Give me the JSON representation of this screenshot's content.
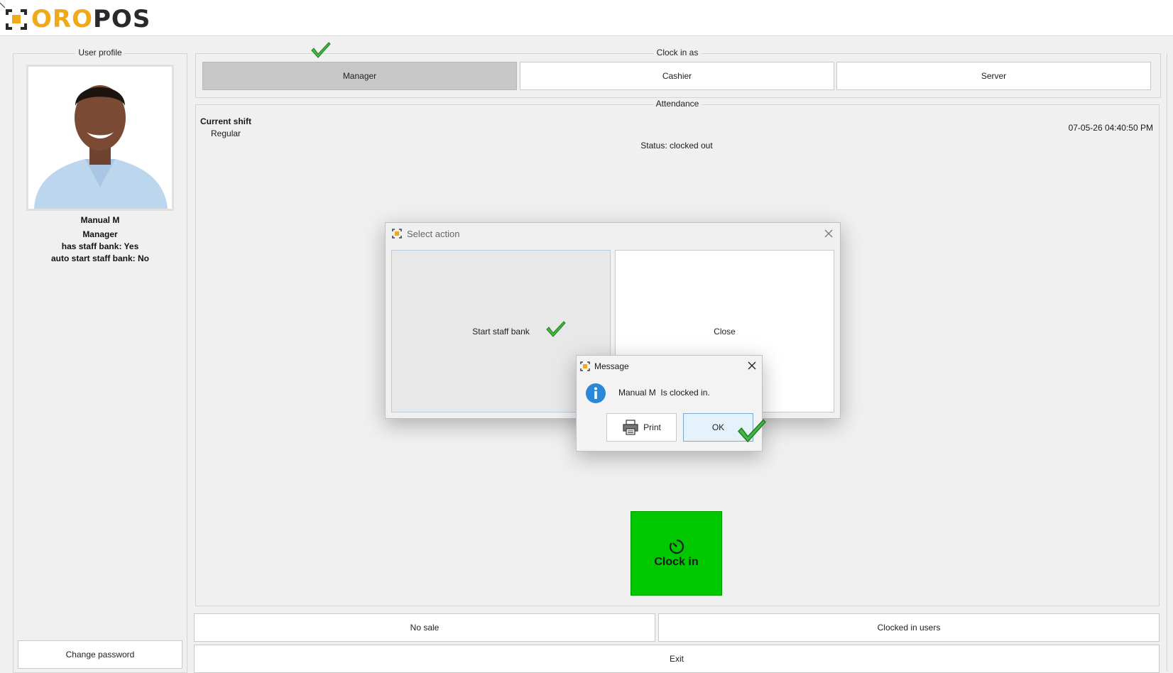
{
  "app": {
    "logo_part1": "ORO",
    "logo_part2": "POS"
  },
  "user_profile": {
    "legend": "User profile",
    "name": "Manual M",
    "role": "Manager",
    "staff_bank": "has staff bank: Yes",
    "auto_start": "auto start staff bank: No",
    "change_password_label": "Change password"
  },
  "clock_in_as": {
    "legend": "Clock in as",
    "roles": [
      {
        "label": "Manager",
        "selected": true
      },
      {
        "label": "Cashier",
        "selected": false
      },
      {
        "label": "Server",
        "selected": false
      }
    ]
  },
  "attendance": {
    "legend": "Attendance",
    "current_shift_label": "Current shift",
    "shift_name": "Regular",
    "timestamp": "07-05-26 04:40:50 PM",
    "status": "Status: clocked out",
    "clock_in_label": "Clock in",
    "clock_in_color": "#00c800"
  },
  "bottom_buttons": {
    "no_sale": "No sale",
    "clocked_in_users": "Clocked in users",
    "exit": "Exit"
  },
  "select_action_dialog": {
    "title": "Select action",
    "start_staff_bank_label": "Start staff bank",
    "close_label": "Close"
  },
  "message_dialog": {
    "title": "Message",
    "message": "Manual M  Is clocked in.",
    "print_label": "Print",
    "ok_label": "OK"
  },
  "colors": {
    "accent": "#f0a91b",
    "check_green": "#3fb93f",
    "info_blue": "#2b88d8"
  }
}
